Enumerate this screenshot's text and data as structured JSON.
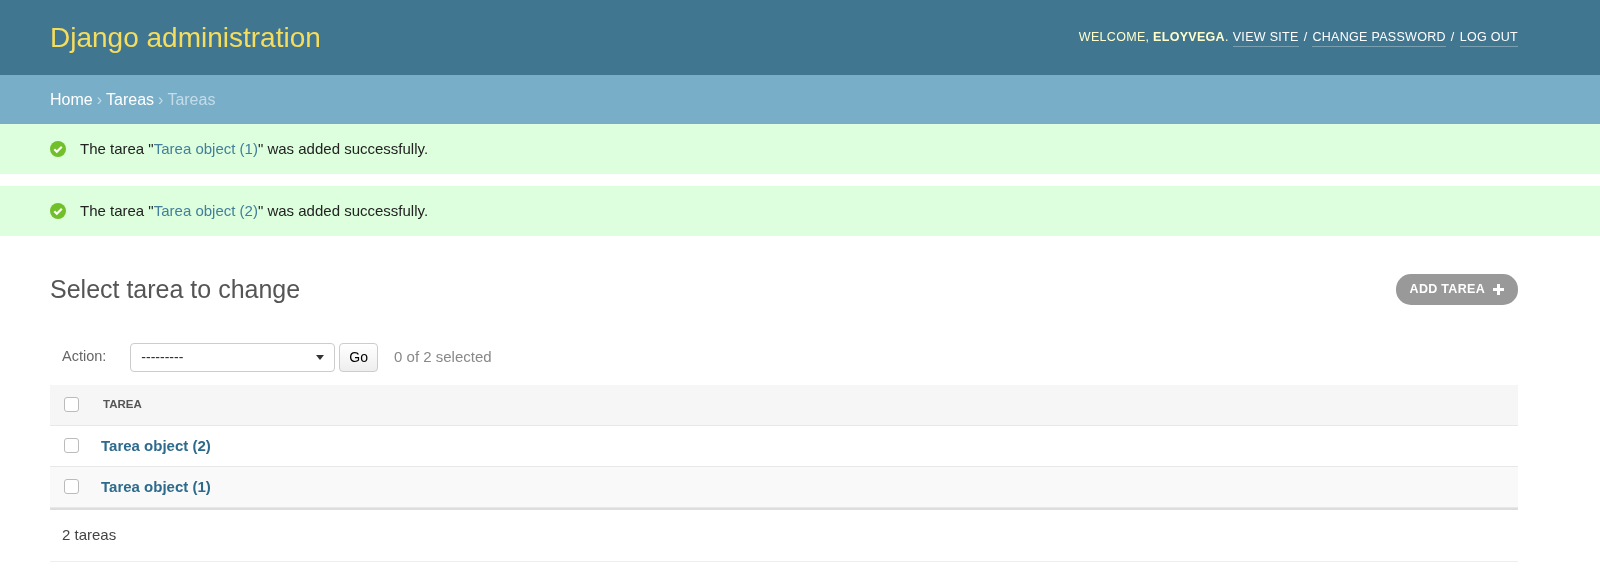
{
  "header": {
    "title": "Django administration",
    "welcome": "WELCOME, **ELOYVEGA**.",
    "links": [
      "VIEW SITE",
      "CHANGE PASSWORD",
      "LOG OUT"
    ],
    "separator": "/"
  },
  "breadcrumbs": {
    "items": [
      {
        "label": "Home",
        "current": false
      },
      {
        "label": "Tareas",
        "current": false
      },
      {
        "label": "Tareas",
        "current": true
      }
    ],
    "separator": "›"
  },
  "messages": [
    {
      "before": "The tarea \"",
      "link": "Tarea object (1)",
      "after": "\" was added successfully."
    },
    {
      "before": "The tarea \"",
      "link": "Tarea object (2)",
      "after": "\" was added successfully."
    }
  ],
  "content": {
    "title": "Select tarea to change",
    "add_button": "ADD TAREA",
    "action_label": "Action:",
    "action_value": "---------",
    "go_button": "Go",
    "selected_count": "0 of 2 selected"
  },
  "table": {
    "select_all_checked": false,
    "columns": [
      "TAREA"
    ],
    "rows": [
      {
        "label": "Tarea object (2)",
        "checked": false
      },
      {
        "label": "Tarea object (1)",
        "checked": false
      }
    ],
    "footer": "2 tareas"
  }
}
